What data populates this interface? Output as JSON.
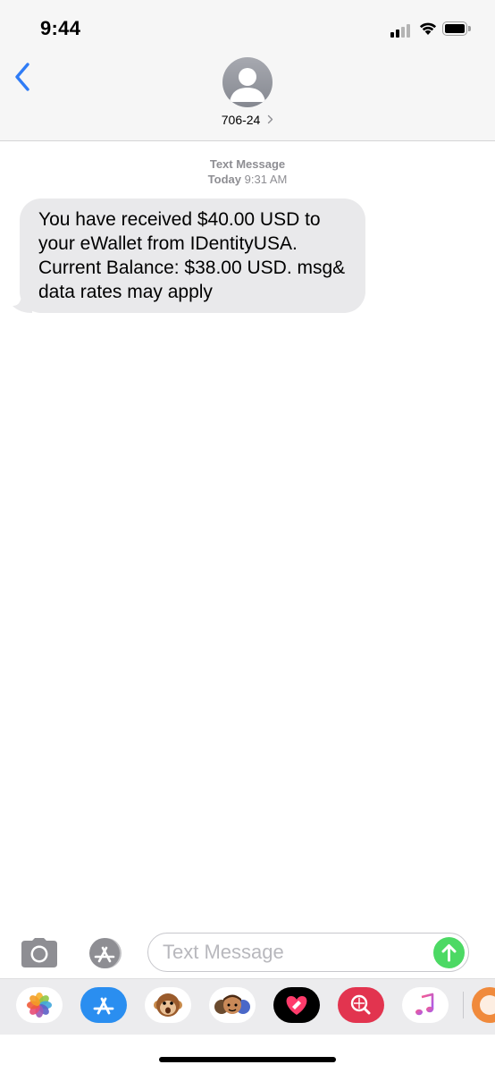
{
  "status_bar": {
    "time": "9:44",
    "signal_icon": "cellular-signal-icon",
    "wifi_icon": "wifi-icon",
    "battery_icon": "battery-icon"
  },
  "header": {
    "back_icon": "chevron-left-icon",
    "contact_name": "706-24",
    "avatar_icon": "person-silhouette-icon",
    "accent_color": "#2f7cf6"
  },
  "conversation": {
    "timestamp_label": "Text Message",
    "timestamp_day": "Today",
    "timestamp_time": "9:31 AM",
    "messages": [
      {
        "direction": "incoming",
        "text": "You have received $40.00 USD to your eWallet from IDentityUSA. Current Balance: $38.00 USD. msg& data rates may apply"
      }
    ]
  },
  "composer": {
    "camera_icon": "camera-icon",
    "apps_icon": "app-store-icon",
    "placeholder": "Text Message",
    "value": "",
    "send_icon": "arrow-up-icon",
    "send_color": "#4cd964"
  },
  "app_drawer": {
    "apps": [
      {
        "name": "photos-app-icon"
      },
      {
        "name": "app-store-app-icon"
      },
      {
        "name": "animoji-app-icon"
      },
      {
        "name": "memoji-stickers-app-icon"
      },
      {
        "name": "digital-touch-app-icon"
      },
      {
        "name": "web-images-search-app-icon"
      },
      {
        "name": "music-app-icon"
      },
      {
        "name": "partial-app-icon"
      }
    ]
  }
}
